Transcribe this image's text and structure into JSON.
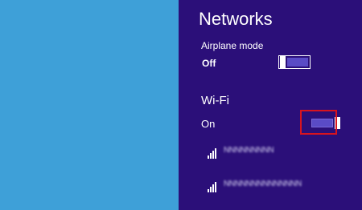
{
  "colors": {
    "desktop_background": "#3ea0d8",
    "panel_background": "#2b0f79",
    "toggle_fill": "#5a4bc6",
    "highlight": "#d8141e"
  },
  "panel": {
    "title": "Networks"
  },
  "airplane_mode": {
    "label": "Airplane mode",
    "state": "Off",
    "is_on": false
  },
  "wifi": {
    "label": "Wi-Fi",
    "state": "On",
    "is_on": true
  },
  "networks": [
    {
      "name": "NNNNNNNNN",
      "icon": "wifi-signal-icon",
      "signal_bars": 4
    },
    {
      "name": "NNNNNNNNNNNNNN",
      "icon": "wifi-signal-icon",
      "signal_bars": 4
    }
  ]
}
